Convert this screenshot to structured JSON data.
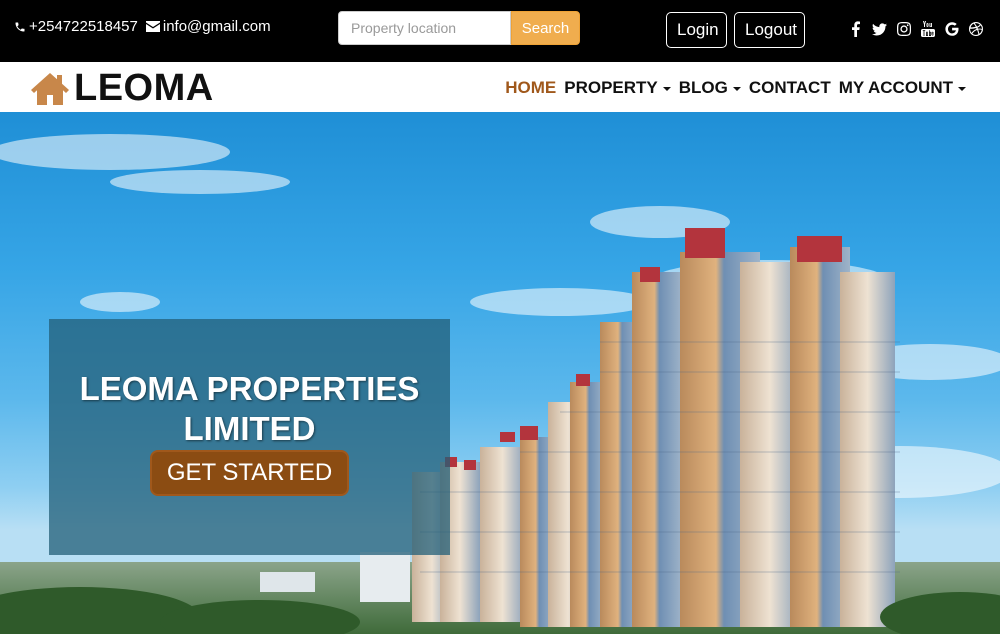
{
  "topbar": {
    "phone": "+254722518457",
    "email": "info@gmail.com",
    "search_placeholder": "Property location",
    "search_button": "Search",
    "login": "Login",
    "logout": "Logout",
    "social_icons": [
      "facebook-icon",
      "twitter-icon",
      "instagram-icon",
      "youtube-icon",
      "google-icon",
      "dribbble-icon"
    ]
  },
  "nav": {
    "brand": "LEOMA",
    "items": [
      {
        "label": "HOME"
      },
      {
        "label": "PROPERTY"
      },
      {
        "label": "BLOG"
      },
      {
        "label": "CONTACT"
      },
      {
        "label": "MY ACCOUNT"
      }
    ]
  },
  "hero": {
    "title": "LEOMA PROPERTIES LIMITED",
    "cta": "GET STARTED"
  },
  "colors": {
    "accent": "#a0581b",
    "search_button": "#f0ad4e",
    "brand_icon": "#c8874a"
  }
}
